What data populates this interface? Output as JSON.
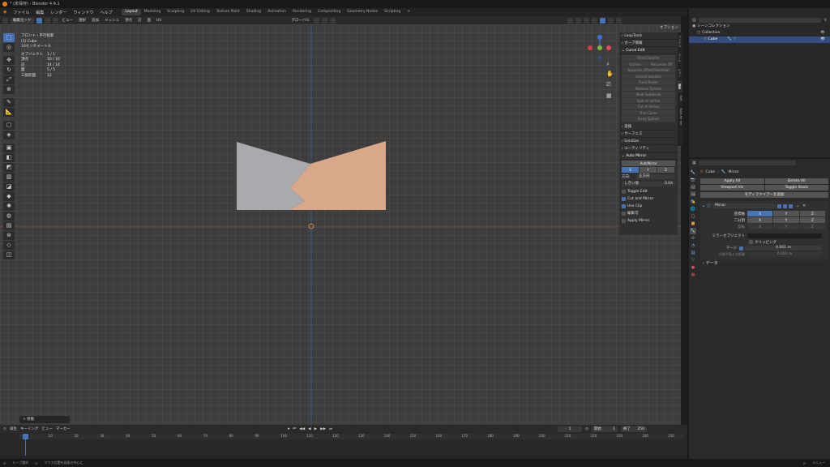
{
  "window": {
    "title": "* (未保存) - Blender 4.4.1"
  },
  "menu": [
    "ファイル",
    "編集",
    "レンダー",
    "ウィンドウ",
    "ヘルプ"
  ],
  "workspaces": [
    "Layout",
    "Modeling",
    "Sculpting",
    "UV Editing",
    "Texture Paint",
    "Shading",
    "Animation",
    "Rendering",
    "Compositing",
    "Geometry Nodes",
    "Scripting"
  ],
  "viewport_header": {
    "mode": "編集モード",
    "menus": [
      "ビュー",
      "選択",
      "追加",
      "メッシュ",
      "頂点",
      "辺",
      "面",
      "UV"
    ],
    "transform": "グローバル",
    "options": "オプション"
  },
  "overlay": {
    "view_name": "フロント・平行投影",
    "object": "(1) Cube",
    "scale": "10センチメートル",
    "stats": [
      {
        "k": "オブジェクト",
        "v": "1 / 1"
      },
      {
        "k": "頂点",
        "v": "10 / 10"
      },
      {
        "k": "辺",
        "v": "14 / 14"
      },
      {
        "k": "面",
        "v": "5 / 5"
      },
      {
        "k": "三角形面",
        "v": "12"
      }
    ]
  },
  "sidebar": {
    "panels_top": [
      "LoopTools",
      "カーブ情報"
    ],
    "curve_edit": {
      "title": "Curve Edit",
      "buttons": [
        "Fillet/Chamfer",
        "Outline",
        "Recursive Off",
        "Separate Offset/Selection",
        "Extend Handles",
        "Fixed Bezier",
        "Remove Splines",
        "Multi Subdivide",
        "Split at Vertex",
        "Cut at Vertex",
        "Trim Curve",
        "Array Splines"
      ]
    },
    "panels_mid": [
      "変換",
      "サーフェス",
      "Sanitize",
      "ユーティリティ"
    ],
    "auto_mirror": {
      "title": "Auto Mirror",
      "button": "AutoMirror",
      "axes": [
        "X",
        "Y",
        "Z"
      ],
      "direction_label": "方向:",
      "direction": "正方向",
      "threshold_label": "しきい値",
      "threshold": "0.04",
      "checks": [
        {
          "label": "Toggle Edit",
          "on": false
        },
        {
          "label": "Cut and Mirror",
          "on": true
        },
        {
          "label": "Use Clip",
          "on": true
        },
        {
          "label": "編集可",
          "on": false
        },
        {
          "label": "Apply Mirror",
          "on": false
        }
      ]
    },
    "tabs": [
      "アイテム",
      "ツール",
      "ビュー",
      "編集",
      "Edit",
      "Tools for me"
    ]
  },
  "outliner": {
    "scene_label": "Scene",
    "viewlayer_label": "ViewLayer",
    "search_placeholder": "",
    "rows": [
      {
        "label": "シーンコレクション",
        "sel": false
      },
      {
        "label": "Collection",
        "sel": false
      },
      {
        "label": "Cube",
        "sel": true
      }
    ]
  },
  "properties": {
    "object": "Cube",
    "modifier_target": "Mirror",
    "apply_all": "Apply All",
    "delete_all": "Delete All",
    "viewport_vis": "Viewport Vis",
    "toggle_stack": "Toggle Stack",
    "add_modifier": "モディファイアーを追加",
    "modifier_name": "Mirror",
    "axis_label": "座標軸",
    "bisect_label": "二分割",
    "flip_label": "反転",
    "axes": [
      "X",
      "Y",
      "Z"
    ],
    "mirror_object_label": "ミラーオブジェクト",
    "clipping": "クリッピング",
    "merge_label": "マージ",
    "merge_value": "0.001 m",
    "bisect_dist_label": "分割平面との距離",
    "bisect_dist_value": "0.001 m",
    "data_label": "データ"
  },
  "timeline": {
    "menus": [
      "再生",
      "キーイング",
      "ビュー",
      "マーカー"
    ],
    "current_frame": "1",
    "start_label": "開始",
    "start": "1",
    "end_label": "終了",
    "end": "250",
    "ticks": [
      "1",
      "10",
      "20",
      "30",
      "40",
      "50",
      "60",
      "70",
      "80",
      "90",
      "100",
      "110",
      "120",
      "130",
      "140",
      "150",
      "160",
      "170",
      "180",
      "190",
      "200",
      "210",
      "220",
      "230",
      "240",
      "250"
    ]
  },
  "op_panel": "> 移動",
  "statusbar": [
    "ループ選択",
    "マウス位置を画面の中心に",
    "メニュー"
  ],
  "version": "4.4.1",
  "colors": {
    "accent": "#4772b3",
    "mesh_left": "#a8aaad",
    "mesh_right": "#d9a78a",
    "selected_row": "#334d80"
  }
}
